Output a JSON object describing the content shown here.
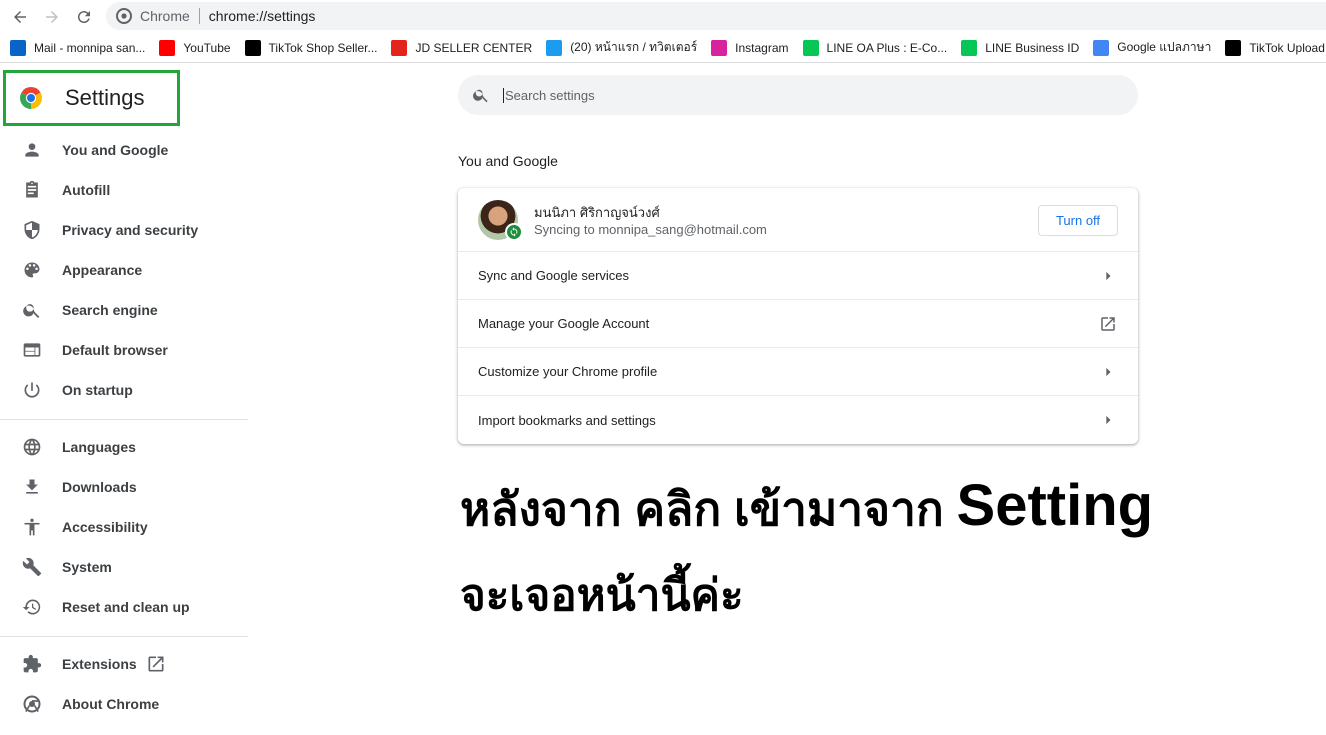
{
  "browser": {
    "site_name": "Chrome",
    "url": "chrome://settings"
  },
  "bookmarks": [
    {
      "label": "Mail - monnipa san...",
      "icon": "outlook-icon",
      "color": "#0a64c8"
    },
    {
      "label": "YouTube",
      "icon": "youtube-icon",
      "color": "#ff0000"
    },
    {
      "label": "TikTok Shop Seller...",
      "icon": "tiktok-icon",
      "color": "#000000"
    },
    {
      "label": "JD SELLER CENTER",
      "icon": "jd-icon",
      "color": "#e1251b"
    },
    {
      "label": "(20) หน้าแรก / ทวิตเตอร์",
      "icon": "twitter-icon",
      "color": "#1d9bf0"
    },
    {
      "label": "Instagram",
      "icon": "instagram-icon",
      "color": "#d6249f"
    },
    {
      "label": "LINE OA Plus : E-Co...",
      "icon": "line-icon",
      "color": "#06c755"
    },
    {
      "label": "LINE Business ID",
      "icon": "line-business-icon",
      "color": "#06c755"
    },
    {
      "label": "Google แปลภาษา",
      "icon": "google-translate-icon",
      "color": "#4285f4"
    },
    {
      "label": "TikTok Upload",
      "icon": "tiktok-icon",
      "color": "#000000"
    }
  ],
  "sidebar": {
    "title": "Settings",
    "items": [
      {
        "label": "You and Google",
        "icon": "person-icon"
      },
      {
        "label": "Autofill",
        "icon": "clipboard-icon"
      },
      {
        "label": "Privacy and security",
        "icon": "shield-icon"
      },
      {
        "label": "Appearance",
        "icon": "palette-icon"
      },
      {
        "label": "Search engine",
        "icon": "search-icon"
      },
      {
        "label": "Default browser",
        "icon": "browser-icon"
      },
      {
        "label": "On startup",
        "icon": "power-icon"
      },
      {
        "label": "Languages",
        "icon": "globe-icon"
      },
      {
        "label": "Downloads",
        "icon": "download-icon"
      },
      {
        "label": "Accessibility",
        "icon": "accessibility-icon"
      },
      {
        "label": "System",
        "icon": "wrench-icon"
      },
      {
        "label": "Reset and clean up",
        "icon": "history-icon"
      },
      {
        "label": "Extensions",
        "icon": "puzzle-icon"
      },
      {
        "label": "About Chrome",
        "icon": "chrome-icon"
      }
    ]
  },
  "search": {
    "placeholder": "Search settings"
  },
  "main": {
    "section_title": "You and Google",
    "profile": {
      "name": "มนนิภา ศิริกาญจน์วงศ์",
      "sync_text": "Syncing to monnipa_sang@hotmail.com",
      "turn_off_label": "Turn off"
    },
    "rows": [
      {
        "label": "Sync and Google services",
        "icon": "arrow-right-icon"
      },
      {
        "label": "Manage your Google Account",
        "icon": "open-in-new-icon"
      },
      {
        "label": "Customize your Chrome profile",
        "icon": "arrow-right-icon"
      },
      {
        "label": "Import bookmarks and settings",
        "icon": "arrow-right-icon"
      }
    ]
  },
  "caption": {
    "line1_thai": "หลังจาก คลิก เข้ามาจาก ",
    "line1_latin": "Setting",
    "line2": "จะเจอหน้านี้ค่ะ"
  },
  "colors": {
    "highlight_box": "#22a53a",
    "link_blue": "#1a73e8",
    "sync_green": "#1e8e3e"
  }
}
